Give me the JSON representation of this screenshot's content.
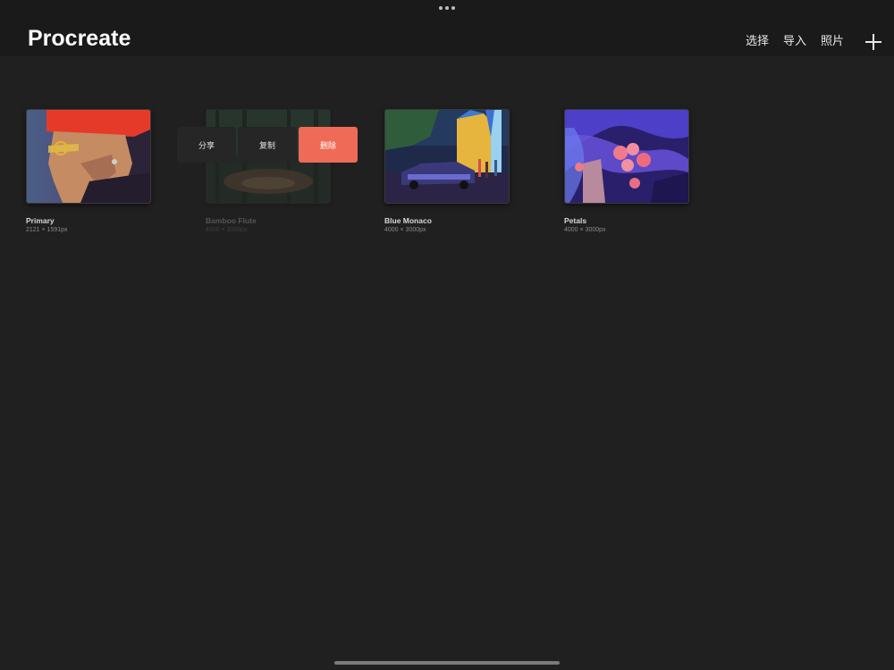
{
  "app": {
    "title": "Procreate"
  },
  "toolbar": {
    "select_label": "选择",
    "import_label": "导入",
    "photos_label": "照片",
    "add_icon": "plus-icon"
  },
  "gallery": {
    "artworks": [
      {
        "title": "Primary",
        "size": "2121 × 1591px"
      },
      {
        "title": "Bamboo Flute",
        "size": "4000 × 3000px"
      },
      {
        "title": "Blue Monaco",
        "size": "4000 × 3000px"
      },
      {
        "title": "Petals",
        "size": "4000 × 3000px"
      }
    ]
  },
  "context_menu": {
    "share_label": "分享",
    "duplicate_label": "复制",
    "delete_label": "删除"
  },
  "colors": {
    "background": "#202020",
    "header": "#1a1a1a",
    "delete_accent": "#ef6a57"
  }
}
